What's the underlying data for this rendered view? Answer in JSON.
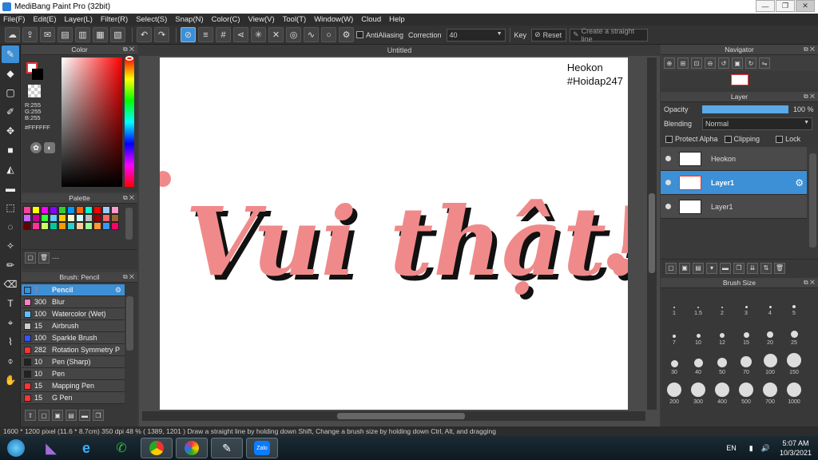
{
  "window": {
    "title": "MediBang Paint Pro (32bit)"
  },
  "menu": [
    "File(F)",
    "Edit(E)",
    "Layer(L)",
    "Filter(R)",
    "Select(S)",
    "Snap(N)",
    "Color(C)",
    "View(V)",
    "Tool(T)",
    "Window(W)",
    "Cloud",
    "Help"
  ],
  "toolbar": {
    "antialiasing_label": "AntiAliasing",
    "correction_label": "Correction",
    "correction_value": "40",
    "key_label": "Key",
    "reset_label": "Reset",
    "straight_line_label": "Create a straight line"
  },
  "color_panel": {
    "title": "Color",
    "r": "R:255",
    "g": "G:255",
    "b": "B:255",
    "hex": "#FFFFFF"
  },
  "palette_panel": {
    "title": "Palette",
    "footer_text": "---",
    "colors": [
      "#ff3fa0",
      "#ffff00",
      "#ff00ff",
      "#8a00ff",
      "#33cc33",
      "#0099ff",
      "#ff6600",
      "#00ffcc",
      "#ff0000",
      "#99ccff",
      "#ff99cc",
      "#cc66ff",
      "#cc0099",
      "#33ff33",
      "#66ccff",
      "#ffcc00",
      "#ffffcc",
      "#ccffff",
      "#c0c0c0",
      "#990000",
      "#ff6666",
      "#996633",
      "#660000",
      "#ff3399",
      "#ccff66",
      "#00cc99",
      "#ff9900",
      "#33cccc",
      "#ffcc99",
      "#99ff99",
      "#ff9933",
      "#3399ff",
      "#ff0066"
    ]
  },
  "brush_panel": {
    "title": "Brush: Pencil",
    "brushes": [
      {
        "size": "7",
        "name": "Pencil",
        "color": "#3d8fd6"
      },
      {
        "size": "300",
        "name": "Blur",
        "color": "#ff80c0"
      },
      {
        "size": "100",
        "name": "Watercolor (Wet)",
        "color": "#60c0ff"
      },
      {
        "size": "15",
        "name": "Airbrush",
        "color": "#cccccc"
      },
      {
        "size": "100",
        "name": "Sparkle Brush",
        "color": "#3355ff"
      },
      {
        "size": "282",
        "name": "Rotation Symmetry P",
        "color": "#ff3333"
      },
      {
        "size": "10",
        "name": "Pen (Sharp)",
        "color": "#222222"
      },
      {
        "size": "10",
        "name": "Pen",
        "color": "#222222"
      },
      {
        "size": "15",
        "name": "Mapping Pen",
        "color": "#ff3333"
      },
      {
        "size": "15",
        "name": "G Pen",
        "color": "#ff3333"
      }
    ]
  },
  "canvas": {
    "tab_title": "Untitled",
    "watermark_line1": "Heokon",
    "watermark_line2": "#Hoidap247",
    "artwork_text": "Vui thật!"
  },
  "navigator": {
    "title": "Navigator"
  },
  "layer_panel": {
    "title": "Layer",
    "opacity_label": "Opacity",
    "opacity_value": "100 %",
    "opacity_fraction": 1.0,
    "blending_label": "Blending",
    "blending_value": "Normal",
    "protect_alpha_label": "Protect Alpha",
    "clipping_label": "Clipping",
    "lock_label": "Lock",
    "layers": [
      {
        "name": "Heokon",
        "selected": false
      },
      {
        "name": "Layer1",
        "selected": true
      },
      {
        "name": "Layer1",
        "selected": false
      }
    ]
  },
  "brush_size_panel": {
    "title": "Brush Size",
    "sizes": [
      "1",
      "1.5",
      "2",
      "3",
      "4",
      "5",
      "7",
      "10",
      "12",
      "15",
      "20",
      "25",
      "30",
      "40",
      "50",
      "70",
      "100",
      "150",
      "200",
      "300",
      "400",
      "500",
      "700",
      "1000"
    ]
  },
  "status": {
    "text": "1600 * 1200 pixel   (11.6 * 8.7cm)   350 dpi   48 %   ( 1389, 1201 )   Draw a straight line by holding down Shift, Change a brush size by holding down Ctrl, Alt, and dragging"
  },
  "taskbar": {
    "lang": "EN",
    "time": "5:07 AM",
    "date": "10/3/2021",
    "apps": [
      "windows-start",
      "visual-studio",
      "internet-explorer",
      "zalo-app",
      "chrome",
      "picasa",
      "medibang",
      "zalo"
    ]
  },
  "colors": {
    "accent": "#3d8fd6",
    "artwork": "#f08a8a",
    "outline": "#111111"
  }
}
